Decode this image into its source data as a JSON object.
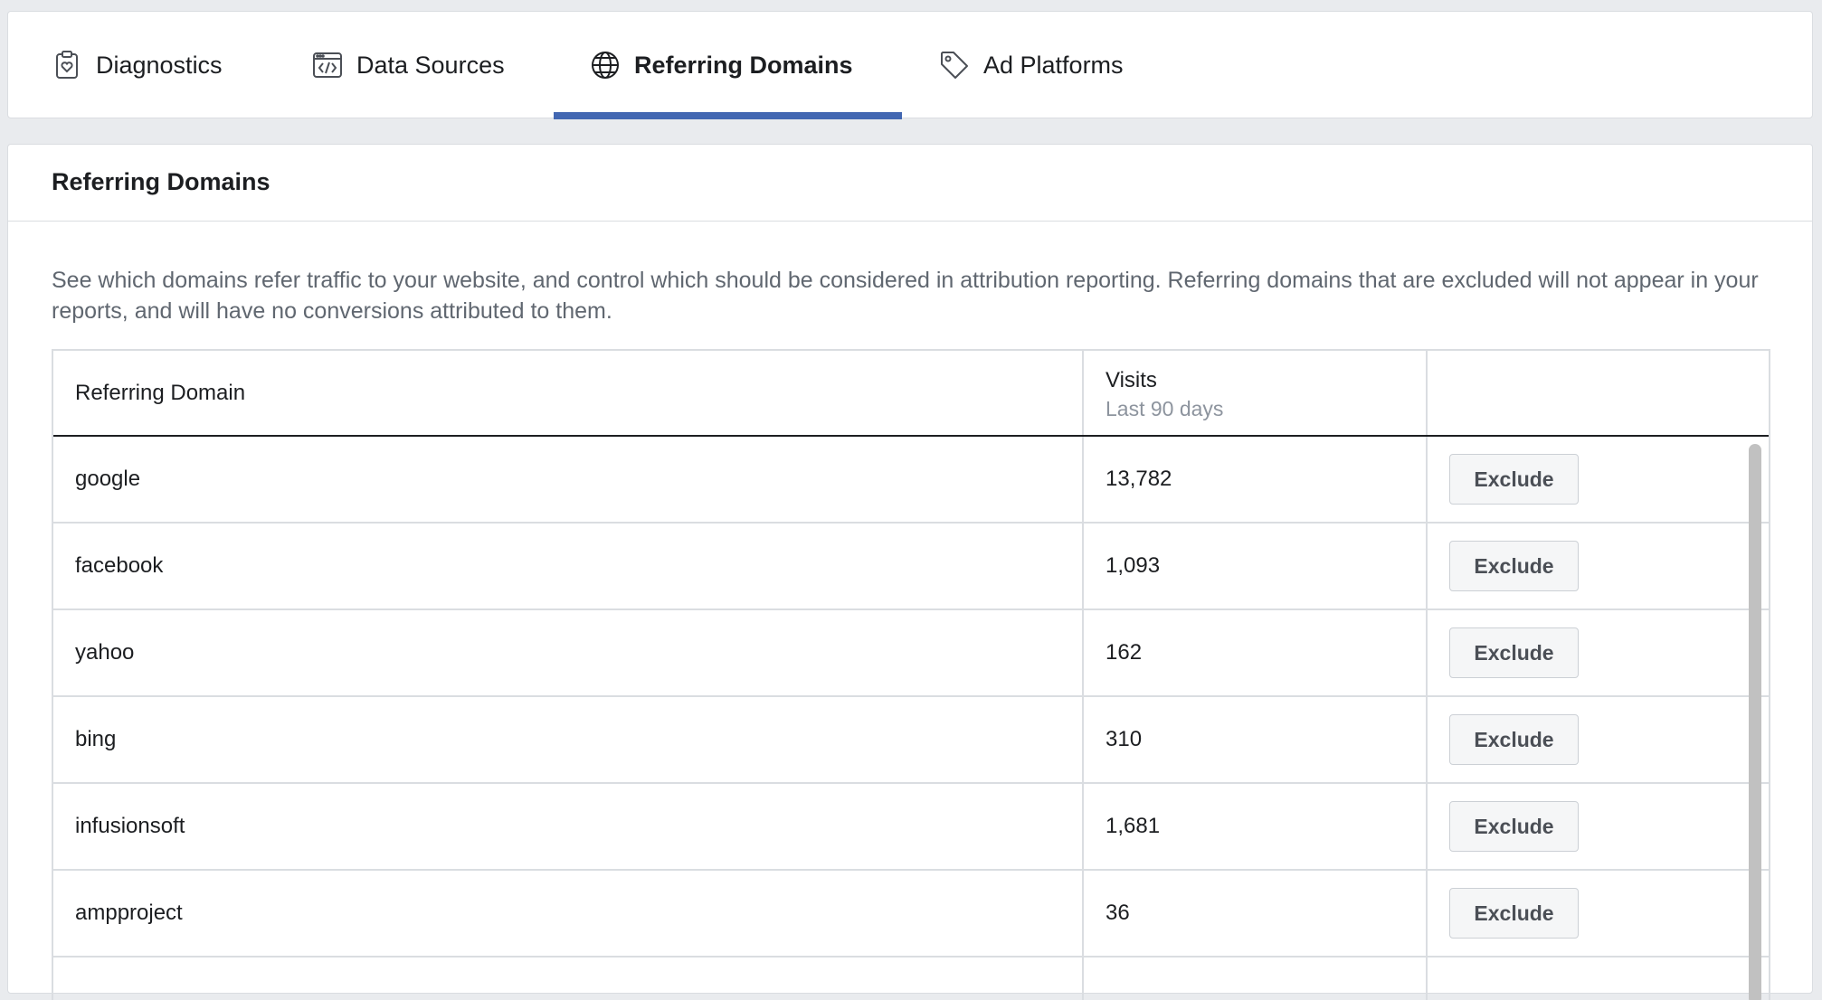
{
  "tabs": [
    {
      "label": "Diagnostics",
      "icon": "clipboard-heart-icon"
    },
    {
      "label": "Data Sources",
      "icon": "code-window-icon"
    },
    {
      "label": "Referring Domains",
      "icon": "globe-icon",
      "active": true
    },
    {
      "label": "Ad Platforms",
      "icon": "tag-icon"
    }
  ],
  "colors": {
    "accent": "#4267b2",
    "background": "#e9ebee"
  },
  "card": {
    "title": "Referring Domains",
    "description": "See which domains refer traffic to your website, and control which should be considered in attribution reporting. Referring domains that are excluded will not appear in your reports, and will have no conversions attributed to them."
  },
  "table": {
    "columns": {
      "domain": "Referring Domain",
      "visits": "Visits",
      "visits_sub": "Last 90 days"
    },
    "rows": [
      {
        "domain": "google",
        "visits": "13,782",
        "action": "Exclude"
      },
      {
        "domain": "facebook",
        "visits": "1,093",
        "action": "Exclude"
      },
      {
        "domain": "yahoo",
        "visits": "162",
        "action": "Exclude"
      },
      {
        "domain": "bing",
        "visits": "310",
        "action": "Exclude"
      },
      {
        "domain": "infusionsoft",
        "visits": "1,681",
        "action": "Exclude"
      },
      {
        "domain": "ampproject",
        "visits": "36",
        "action": "Exclude"
      }
    ]
  }
}
